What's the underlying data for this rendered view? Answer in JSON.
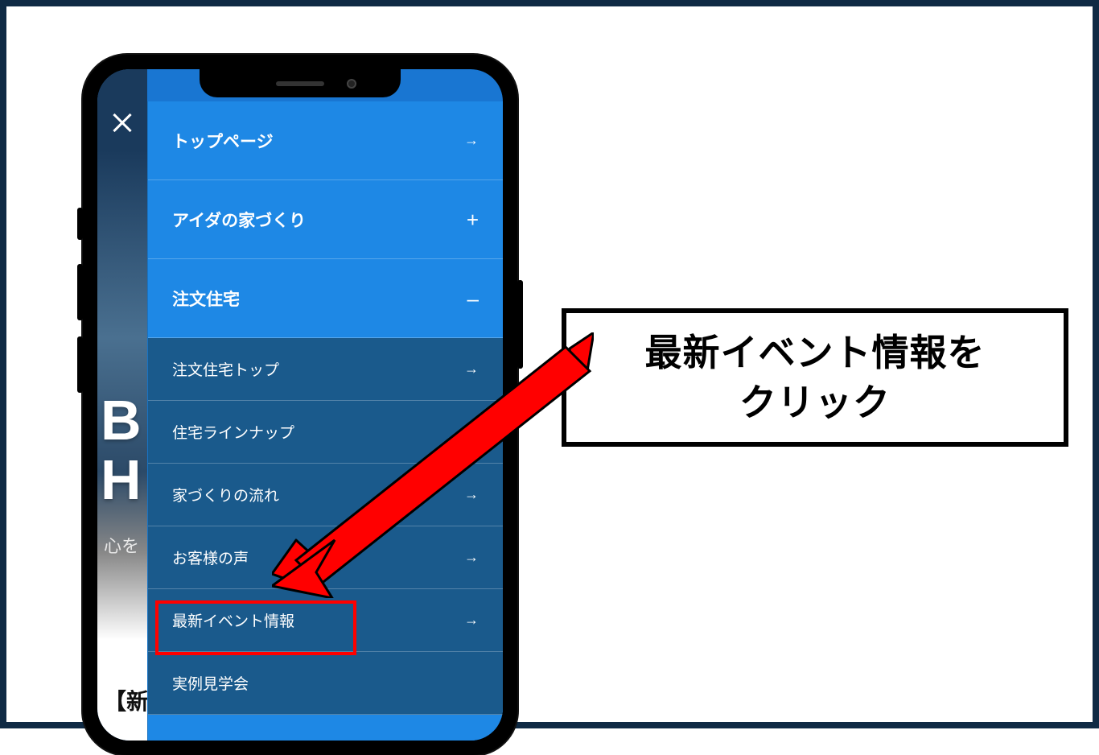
{
  "background": {
    "heading_line1": "B",
    "heading_line2": "H",
    "subtext": "心を",
    "bottom_text": "【新"
  },
  "menu": {
    "top_items": [
      {
        "label": "トップページ",
        "indicator": "→"
      },
      {
        "label": "アイダの家づくり",
        "indicator": "+"
      },
      {
        "label": "注文住宅",
        "indicator": "–"
      }
    ],
    "sub_items": [
      {
        "label": "注文住宅トップ",
        "indicator": "→"
      },
      {
        "label": "住宅ラインナップ",
        "indicator": ""
      },
      {
        "label": "家づくりの流れ",
        "indicator": "→"
      },
      {
        "label": "お客様の声",
        "indicator": "→"
      },
      {
        "label": "最新イベント情報",
        "indicator": "→",
        "highlighted": true
      },
      {
        "label": "実例見学会",
        "indicator": ""
      }
    ]
  },
  "callout": {
    "line1": "最新イベント情報を",
    "line2": "クリック"
  }
}
